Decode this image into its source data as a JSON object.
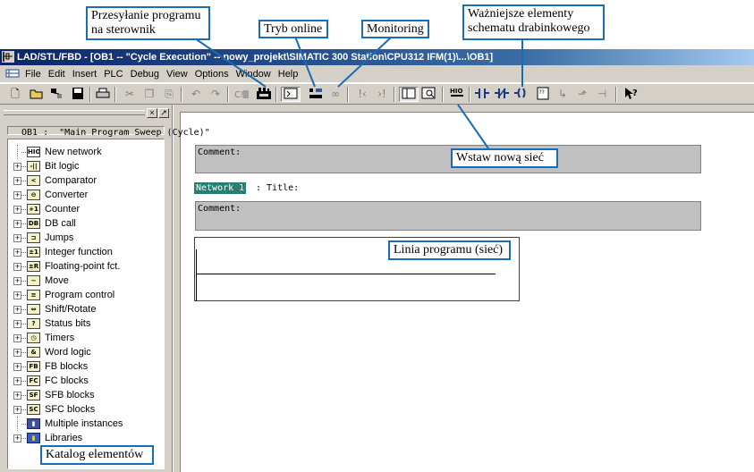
{
  "window": {
    "title": "LAD/STL/FBD - [OB1 -- \"Cycle Execution\" -- nowy_projekt\\SIMATIC 300 Station\\CPU312 IFM(1)\\...\\OB1]"
  },
  "menubar": {
    "items": [
      "File",
      "Edit",
      "Insert",
      "PLC",
      "Debug",
      "View",
      "Options",
      "Window",
      "Help"
    ]
  },
  "toolbar": {
    "buttons": [
      "new-icon",
      "open-icon",
      "accessible-nodes-icon",
      "save-icon",
      "print-icon",
      "cut-icon",
      "copy-icon",
      "paste-icon",
      "undo-icon",
      "redo-icon",
      "load-to-plc-icon",
      "online-mode-icon",
      "monitor-icon",
      "monitor-off-icon",
      "previous-error-icon",
      "next-error-icon",
      "overview-icon",
      "details-icon",
      "new-network-icon",
      "contact-no-icon",
      "contact-nc-icon",
      "coil-icon",
      "empty-box-icon",
      "open-branch-icon",
      "close-branch-icon",
      "connection-icon",
      "help-icon"
    ]
  },
  "catalog": {
    "items": [
      {
        "label": "New network",
        "icon": "HIO",
        "expandable": false
      },
      {
        "label": "Bit logic",
        "icon": "-||",
        "expandable": true
      },
      {
        "label": "Comparator",
        "icon": "<",
        "expandable": true
      },
      {
        "label": "Converter",
        "icon": "⊖",
        "expandable": true
      },
      {
        "label": "Counter",
        "icon": "+1",
        "expandable": true
      },
      {
        "label": "DB call",
        "icon": "DB",
        "expandable": true
      },
      {
        "label": "Jumps",
        "icon": "⊐",
        "expandable": true
      },
      {
        "label": "Integer function",
        "icon": "±1",
        "expandable": true
      },
      {
        "label": "Floating-point fct.",
        "icon": "±R",
        "expandable": true
      },
      {
        "label": "Move",
        "icon": "~",
        "expandable": true
      },
      {
        "label": "Program control",
        "icon": "≡",
        "expandable": true
      },
      {
        "label": "Shift/Rotate",
        "icon": "⇔",
        "expandable": true
      },
      {
        "label": "Status bits",
        "icon": "?",
        "expandable": true
      },
      {
        "label": "Timers",
        "icon": "◷",
        "expandable": true
      },
      {
        "label": "Word logic",
        "icon": "&",
        "expandable": true
      },
      {
        "label": "FB blocks",
        "icon": "FB",
        "expandable": true
      },
      {
        "label": "FC blocks",
        "icon": "FC",
        "expandable": true
      },
      {
        "label": "SFB blocks",
        "icon": "SF",
        "expandable": true
      },
      {
        "label": "SFC blocks",
        "icon": "SC",
        "expandable": true
      },
      {
        "label": "Multiple instances",
        "icon": "▮",
        "expandable": false
      },
      {
        "label": "Libraries",
        "icon": "▮",
        "expandable": true
      }
    ]
  },
  "editor": {
    "block_header": "OB1 :  \"Main Program Sweep (Cycle)\"",
    "comment_label_1": "Comment:",
    "network_label": "Network 1",
    "network_title": ": Title:",
    "comment_label_2": "Comment:"
  },
  "callouts": {
    "download": "Przesyłanie programu\nna sterownik",
    "online": "Tryb online",
    "monitoring": "Monitoring",
    "elements": "Ważniejsze elementy\nschematu drabinkowego",
    "new_network": "Wstaw nową sieć",
    "program_line": "Linia programu (sieć)",
    "catalog": "Katalog elementów"
  },
  "colors": {
    "callout_border": "#1a6cb4",
    "network_label_bg": "#1e7a6e",
    "titlebar_start": "#0a246a",
    "face": "#d4d0c8"
  }
}
